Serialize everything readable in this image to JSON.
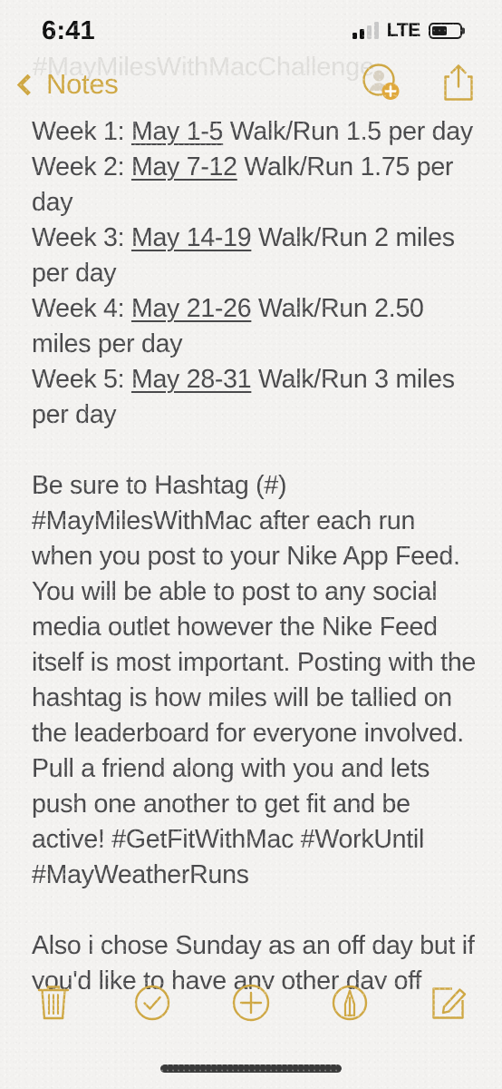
{
  "status_bar": {
    "time": "6:41",
    "carrier_tech": "LTE",
    "signal_bars_total": 4,
    "signal_bars_filled": 2,
    "battery_percent": 55,
    "signal_icon": "cellular-signal-icon",
    "battery_icon": "battery-icon"
  },
  "nav_bar": {
    "back_label": "Notes",
    "back_icon": "chevron-left-icon",
    "ghost_title": "#MayMilesWithMacChallenge",
    "add_people_icon": "add-person-icon",
    "share_icon": "share-icon",
    "accent_color": "#cfa844"
  },
  "note": {
    "blocks": [
      {
        "id": "schedule",
        "lines": [
          {
            "prefix": "Week 1: ",
            "link": "May 1-5",
            "suffix": " Walk/Run 1.5 per day"
          },
          {
            "prefix": "Week 2: ",
            "link": "May 7-12",
            "suffix": " Walk/Run 1.75 per day"
          },
          {
            "prefix": "Week 3: ",
            "link": "May 14-19",
            "suffix": " Walk/Run 2 miles per day"
          },
          {
            "prefix": "Week 4: ",
            "link": "May 21-26",
            "suffix": " Walk/Run 2.50 miles per day"
          },
          {
            "prefix": "Week 5: ",
            "link": "May 28-31",
            "suffix": " Walk/Run 3 miles per day"
          }
        ]
      },
      {
        "id": "hashtag-instructions",
        "text": "Be sure to Hashtag (#) #MayMilesWithMac after each run when you post to your Nike App Feed. You will be able to post to any social media outlet however the Nike Feed itself is most important. Posting with the hashtag is how miles will be tallied on the leaderboard for everyone involved. Pull a friend along with you and lets push one another to get fit and be active! #GetFitWithMac #WorkUntil #MayWeatherRuns"
      },
      {
        "id": "off-day-note",
        "text": "Also i chose Sunday as an off day but if you'd like to have any other day off thats fine by me. If you choose to not have an off day at all, that's even better!"
      }
    ]
  },
  "toolbar": {
    "accent_color": "#cfa844",
    "buttons": [
      {
        "id": "delete",
        "icon": "trash-icon",
        "label": "Delete"
      },
      {
        "id": "checklist",
        "icon": "checkmark-circle-icon",
        "label": "Checklist"
      },
      {
        "id": "add",
        "icon": "plus-circle-icon",
        "label": "Add"
      },
      {
        "id": "markup",
        "icon": "markup-pen-circle-icon",
        "label": "Markup"
      },
      {
        "id": "compose",
        "icon": "compose-icon",
        "label": "New Note"
      }
    ]
  },
  "home_indicator": {
    "label": "home-indicator"
  }
}
